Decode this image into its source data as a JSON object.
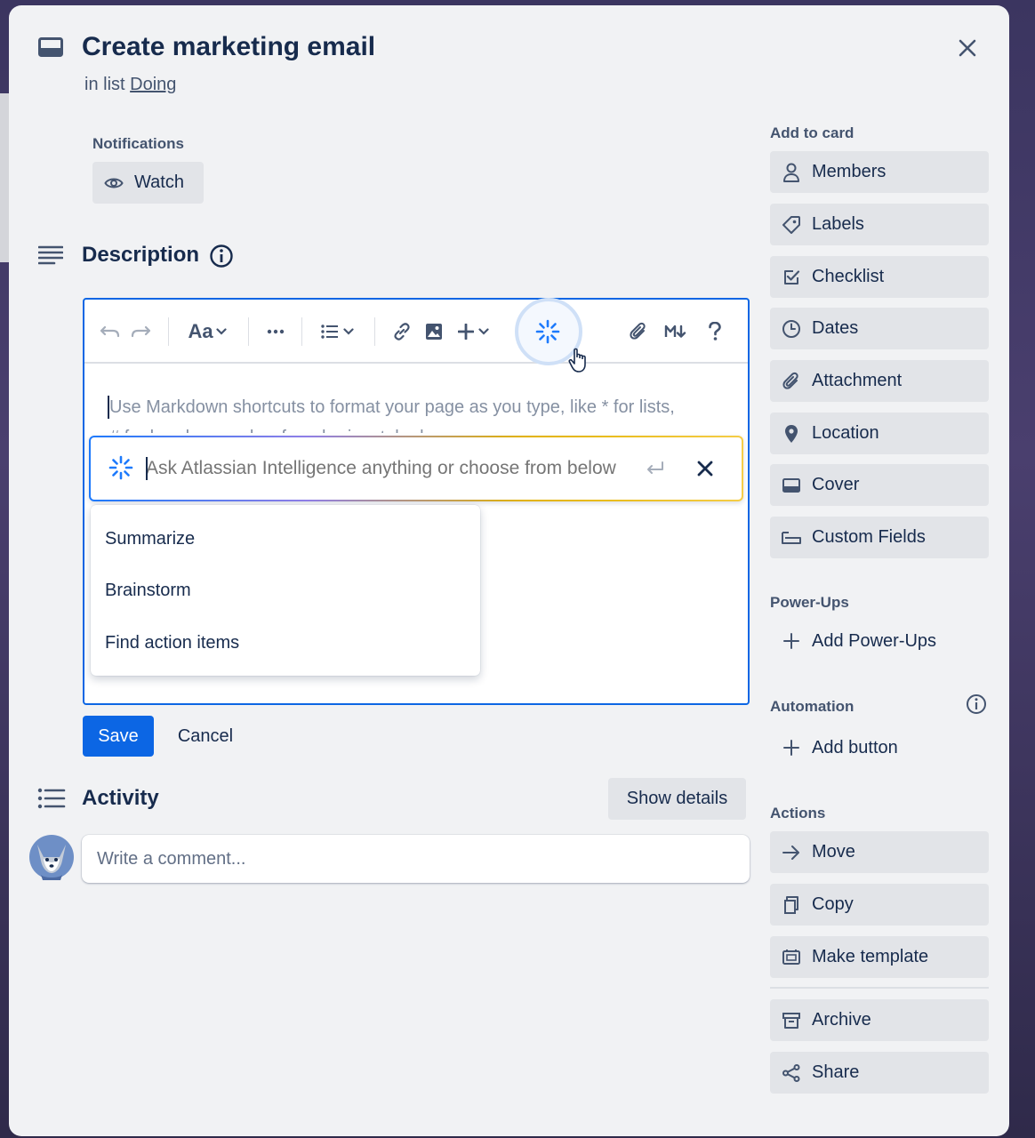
{
  "card": {
    "title": "Create marketing email",
    "in_list_prefix": "in list",
    "list_name": "Doing"
  },
  "notifications": {
    "label": "Notifications",
    "watch_label": "Watch"
  },
  "description": {
    "heading": "Description",
    "placeholder_line1": "Use Markdown shortcuts to format your page as you type, like * for lists,",
    "placeholder_line2": "# for headers, and --- for a horizontal rule.",
    "toolbar": {
      "text_style_label": "Aa"
    }
  },
  "ai_prompt": {
    "placeholder": "Ask Atlassian Intelligence anything or choose from below",
    "options": [
      {
        "label": "Summarize"
      },
      {
        "label": "Brainstorm"
      },
      {
        "label": "Find action items"
      }
    ]
  },
  "editor_actions": {
    "save_label": "Save",
    "cancel_label": "Cancel"
  },
  "activity": {
    "heading": "Activity",
    "show_details_label": "Show details",
    "comment_placeholder": "Write a comment..."
  },
  "sidebar": {
    "add_to_card": {
      "label": "Add to card",
      "items": [
        {
          "label": "Members",
          "icon": "person-icon"
        },
        {
          "label": "Labels",
          "icon": "tag-icon"
        },
        {
          "label": "Checklist",
          "icon": "checkbox-icon"
        },
        {
          "label": "Dates",
          "icon": "clock-icon"
        },
        {
          "label": "Attachment",
          "icon": "paperclip-icon"
        },
        {
          "label": "Location",
          "icon": "pin-icon"
        },
        {
          "label": "Cover",
          "icon": "card-cover-icon"
        },
        {
          "label": "Custom Fields",
          "icon": "custom-fields-icon"
        }
      ]
    },
    "power_ups": {
      "label": "Power-Ups",
      "add_label": "Add Power-Ups"
    },
    "automation": {
      "label": "Automation",
      "add_button_label": "Add button"
    },
    "actions": {
      "label": "Actions",
      "items": [
        {
          "label": "Move",
          "icon": "arrow-right-icon"
        },
        {
          "label": "Copy",
          "icon": "copy-icon"
        },
        {
          "label": "Make template",
          "icon": "template-icon"
        },
        {
          "label": "Archive",
          "icon": "archive-icon"
        },
        {
          "label": "Share",
          "icon": "share-icon"
        }
      ]
    }
  },
  "colors": {
    "primary": "#0c66e4",
    "text": "#172b4d",
    "subtle_text": "#44546f",
    "button_bg": "#e2e4e8",
    "modal_bg": "#f1f2f4"
  }
}
